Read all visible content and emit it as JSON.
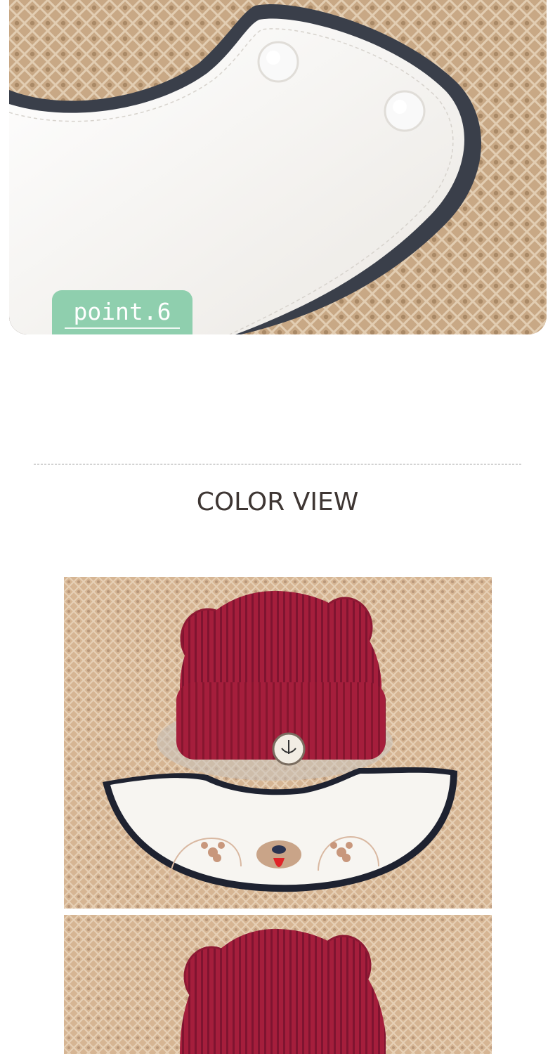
{
  "detail_photo": {
    "badge_label": "point.6",
    "colors": {
      "badge": "#8fcfae",
      "bib_white": "#f6f4f0",
      "piping_navy": "#3a3f4a",
      "knit_tan": "#c9a987"
    }
  },
  "color_view": {
    "title": "COLOR VIEW",
    "photos": [
      {
        "subject": "red corduroy bear-ear hat with white bib",
        "hat_color": "#a51e3c"
      },
      {
        "subject": "red corduroy bear-ear hat",
        "hat_color": "#a51e3c"
      }
    ]
  }
}
